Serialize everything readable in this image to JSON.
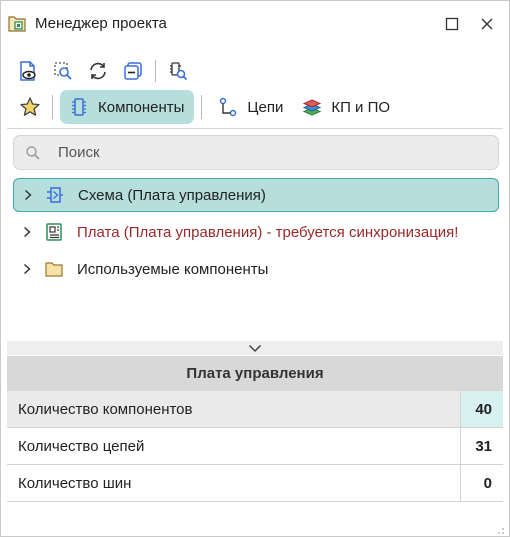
{
  "window": {
    "title": "Менеджер проекта",
    "app_icon": "project-manager-icon",
    "controls": [
      "maximize-icon",
      "close-icon"
    ]
  },
  "toolbar_top": {
    "buttons": [
      "show-document-icon",
      "select-region-icon",
      "refresh-icon",
      "collapse-icon",
      "find-component-icon"
    ]
  },
  "toolbar_tabs": {
    "favorites_icon": "star-icon",
    "tabs": [
      {
        "label": "Компоненты",
        "icon": "component-chip-icon",
        "active": true
      },
      {
        "label": "Цепи",
        "icon": "net-icon",
        "active": false
      },
      {
        "label": "КП и ПО",
        "icon": "layers-icon",
        "active": false
      }
    ]
  },
  "search": {
    "placeholder": "Поиск",
    "value": ""
  },
  "tree": {
    "items": [
      {
        "label": "Схема (Плата управления)",
        "icon": "schematic-icon",
        "selected": true,
        "warning": false
      },
      {
        "label": "Плата (Плата управления) - требуется синхронизация!",
        "icon": "pcb-icon",
        "selected": false,
        "warning": true
      },
      {
        "label": "Используемые компоненты",
        "icon": "folder-icon",
        "selected": false,
        "warning": false
      }
    ]
  },
  "properties": {
    "header": "Плата управления",
    "rows": [
      {
        "key": "Количество компонентов",
        "value": "40"
      },
      {
        "key": "Количество цепей",
        "value": "31"
      },
      {
        "key": "Количество шин",
        "value": "0"
      }
    ]
  },
  "colors": {
    "accent": "#b5dedd",
    "accent_border": "#4aa9a4",
    "warning_text": "#9a2a2a",
    "icon_blue": "#3a6fd8"
  }
}
